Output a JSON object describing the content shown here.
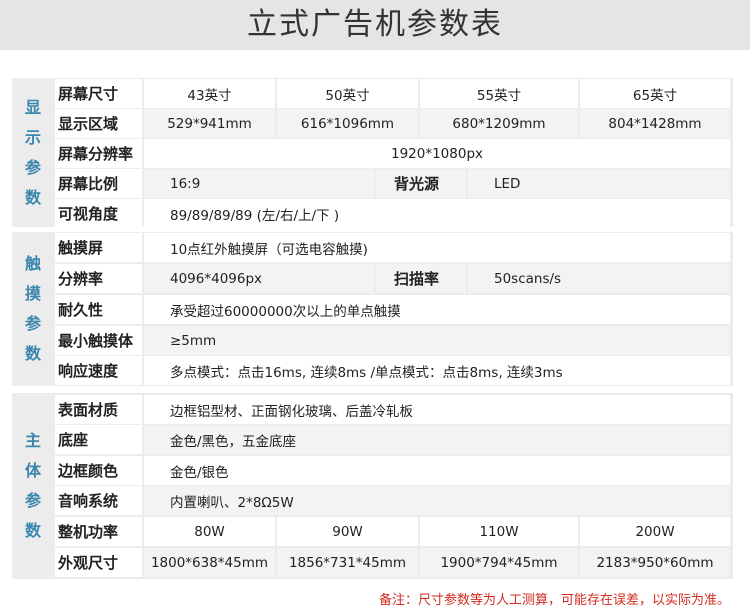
{
  "page": {
    "title": "立式广告机参数表"
  },
  "sections": {
    "display": {
      "label": [
        "显",
        "示",
        "参",
        "数"
      ]
    },
    "touch": {
      "label": [
        "触",
        "摸",
        "参",
        "数"
      ]
    },
    "body": {
      "label": [
        "主",
        "体",
        "参",
        "数"
      ]
    }
  },
  "display": {
    "size": {
      "label": "屏幕尺寸",
      "values": [
        "43英寸",
        "50英寸",
        "55英寸",
        "65英寸"
      ]
    },
    "area": {
      "label": "显示区域",
      "values": [
        "529*941mm",
        "616*1096mm",
        "680*1209mm",
        "804*1428mm"
      ]
    },
    "resolution": {
      "label": "屏幕分辨率",
      "value": "1920*1080px"
    },
    "ratio": {
      "label": "屏幕比例",
      "value": "16:9",
      "backlight_label": "背光源",
      "backlight_value": "LED"
    },
    "angle": {
      "label": "可视角度",
      "value": "89/89/89/89 (左/右/上/下 )"
    }
  },
  "touch": {
    "screen": {
      "label": "触摸屏",
      "value": "10点红外触摸屏（可选电容触摸)"
    },
    "resolution": {
      "label": "分辨率",
      "value": "4096*4096px",
      "scan_label": "扫描率",
      "scan_value": "50scans/s"
    },
    "durability": {
      "label": "耐久性",
      "value": "承受超过60000000次以上的单点触摸"
    },
    "min_body": {
      "label": "最小触摸体",
      "value": "≥5mm"
    },
    "response": {
      "label": "响应速度",
      "value": "多点模式：点击16ms, 连续8ms /单点模式：点击8ms, 连续3ms"
    }
  },
  "body": {
    "material": {
      "label": "表面材质",
      "value": "边框铝型材、正面钢化玻璃、后盖冷轧板"
    },
    "base": {
      "label": "底座",
      "value": "金色/黑色，五金底座"
    },
    "frame_color": {
      "label": "边框颜色",
      "value": "金色/银色"
    },
    "audio": {
      "label": "音响系统",
      "value": "内置喇叭、2*8Ω5W"
    },
    "power": {
      "label": "整机功率",
      "values": [
        "80W",
        "90W",
        "110W",
        "200W"
      ]
    },
    "dimensions": {
      "label": "外观尺寸",
      "values": [
        "1800*638*45mm",
        "1856*731*45mm",
        "1900*794*45mm",
        "2183*950*60mm"
      ]
    }
  },
  "footer": {
    "note": "备注：尺寸参数等为人工测算，可能存在误差，以实际为准。"
  },
  "colors": {
    "section_label": "#3a86ad",
    "note": "#d32a1f",
    "header_bg": "#e5e5e5"
  }
}
